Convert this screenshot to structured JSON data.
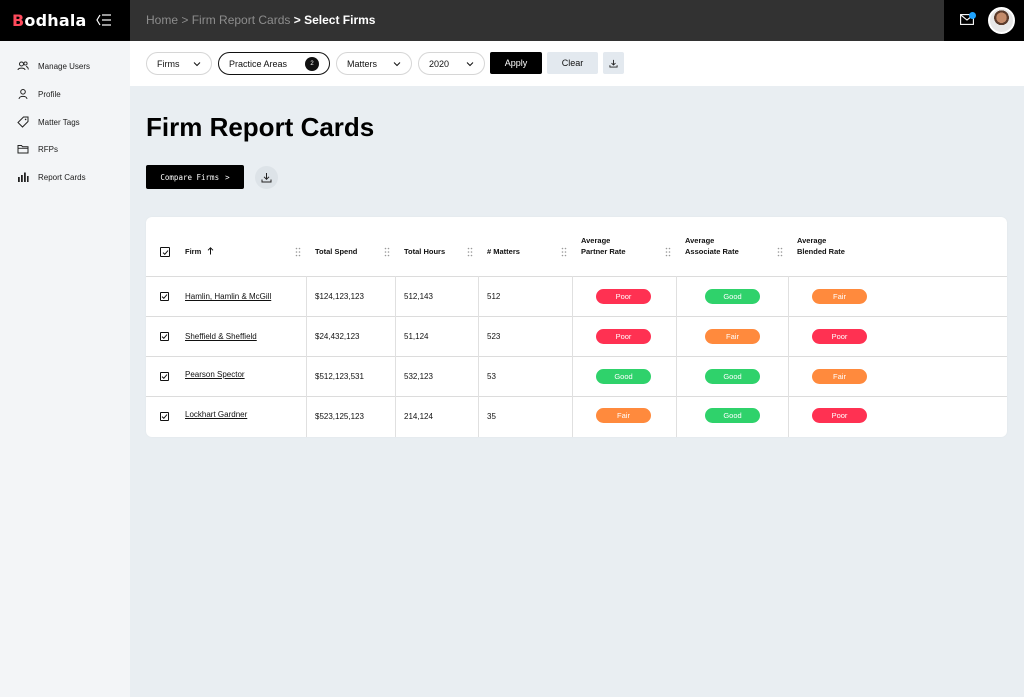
{
  "app": {
    "logo_initial": "B",
    "logo_rest": "odhala"
  },
  "breadcrumb": {
    "home": "Home",
    "sep1": ">",
    "section": "Firm Report Cards",
    "sep2": ">",
    "current": "Select Firms"
  },
  "sidebar": {
    "items": [
      {
        "label": "Manage Users",
        "icon": "users-icon"
      },
      {
        "label": "Profile",
        "icon": "user-icon"
      },
      {
        "label": "Matter Tags",
        "icon": "tag-icon"
      },
      {
        "label": "RFPs",
        "icon": "folder-icon"
      },
      {
        "label": "Report Cards",
        "icon": "bar-chart-icon"
      }
    ]
  },
  "filters": {
    "firms": "Firms",
    "practice_areas": "Practice Areas",
    "practice_areas_count": "2",
    "matters": "Matters",
    "year": "2020",
    "apply": "Apply",
    "clear": "Clear"
  },
  "main": {
    "title": "Firm Report Cards",
    "compare_label": "Compare Firms",
    "compare_chevron": ">"
  },
  "table": {
    "headers": {
      "firm": "Firm",
      "total_spend": "Total Spend",
      "total_hours": "Total Hours",
      "matters": "# Matters",
      "partner_rate_1": "Average",
      "partner_rate_2": "Partner Rate",
      "associate_rate_1": "Average",
      "associate_rate_2": "Associate Rate",
      "blended_rate_1": "Average",
      "blended_rate_2": "Blended Rate"
    },
    "rows": [
      {
        "firm": "Hamlin, Hamlin & McGill",
        "spend": "$124,123,123",
        "hours": "512,143",
        "matters": "512",
        "partner": "Poor",
        "associate": "Good",
        "blended": "Fair"
      },
      {
        "firm": "Sheffield & Sheffield",
        "spend": "$24,432,123",
        "hours": "51,124",
        "matters": "523",
        "partner": "Poor",
        "associate": "Fair",
        "blended": "Poor"
      },
      {
        "firm": "Pearson Spector",
        "spend": "$512,123,531",
        "hours": "532,123",
        "matters": "53",
        "partner": "Good",
        "associate": "Good",
        "blended": "Fair"
      },
      {
        "firm": "Lockhart Gardner",
        "spend": "$523,125,123",
        "hours": "214,124",
        "matters": "35",
        "partner": "Fair",
        "associate": "Good",
        "blended": "Poor"
      }
    ]
  },
  "colors": {
    "poor": "#ff3152",
    "good": "#2fd26b",
    "fair": "#ff8a3d",
    "notification_dot": "#1fa3ff"
  }
}
